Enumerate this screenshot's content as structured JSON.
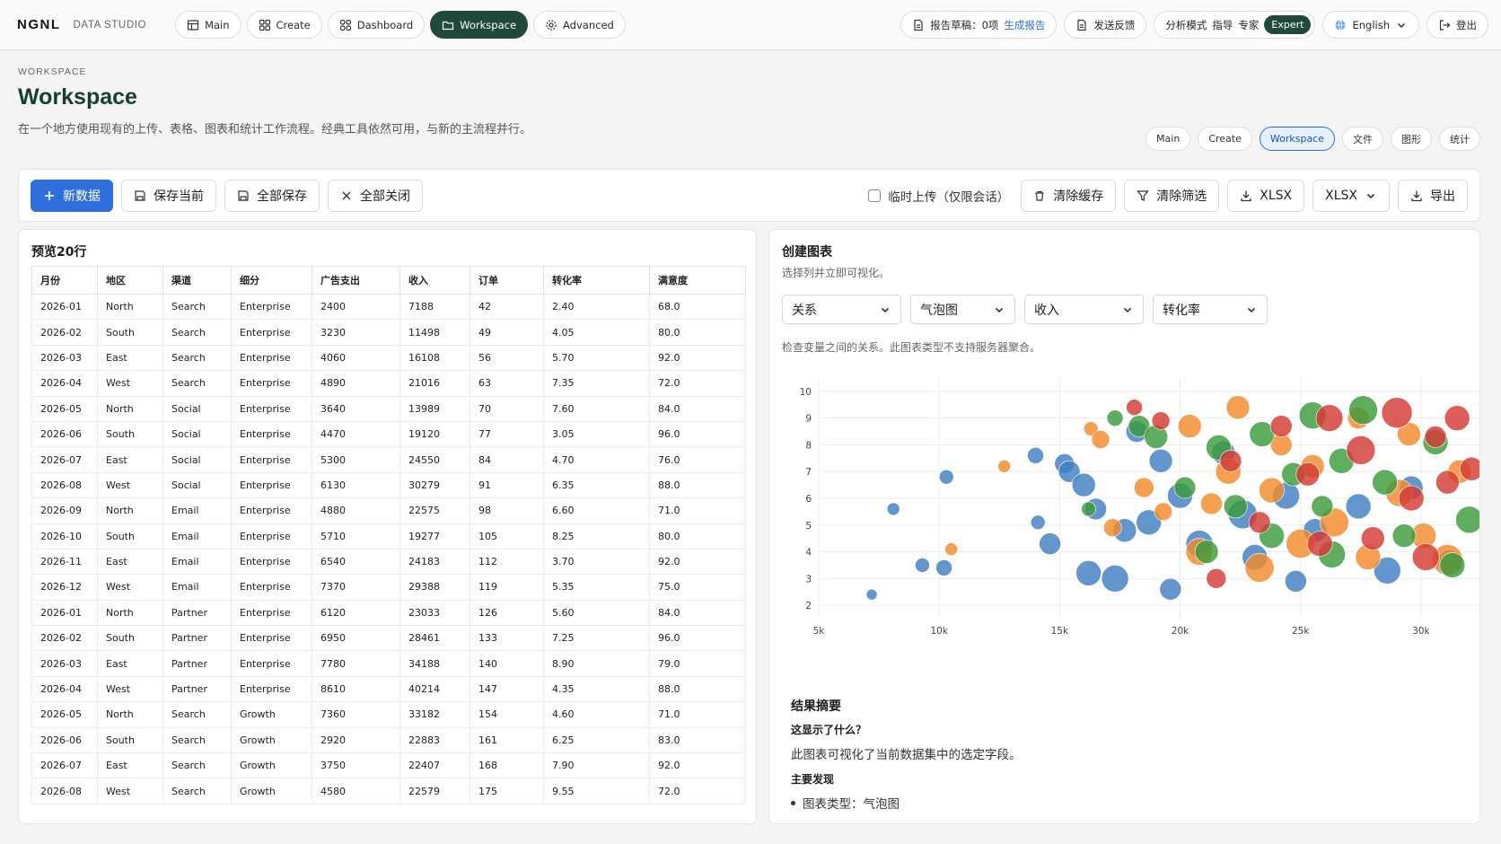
{
  "topbar": {
    "brand": "NGNL",
    "brand_sub": "DATA STUDIO",
    "nav": [
      {
        "label": "Main",
        "icon": "table-icon"
      },
      {
        "label": "Create",
        "icon": "grid-icon"
      },
      {
        "label": "Dashboard",
        "icon": "dashboard-icon"
      },
      {
        "label": "Workspace",
        "icon": "folder-icon",
        "active": true
      },
      {
        "label": "Advanced",
        "icon": "gear-icon"
      }
    ],
    "report_draft": "报告草稿：0项",
    "generate_report": "生成报告",
    "feedback": "发送反馈",
    "mode_label": "分析模式",
    "mode_guide": "指导",
    "mode_expert": "专家",
    "mode_active": "Expert",
    "language": "English",
    "logout": "登出"
  },
  "page": {
    "breadcrumb": "WORKSPACE",
    "title": "Workspace",
    "description": "在一个地方使用现有的上传、表格、图表和统计工作流程。经典工具依然可用，与新的主流程并行。",
    "subtabs": [
      "Main",
      "Create",
      "Workspace",
      "文件",
      "图形",
      "统计"
    ],
    "active_subtab": "Workspace"
  },
  "toolbar": {
    "new_data": "新数据",
    "save_current": "保存当前",
    "save_all": "全部保存",
    "close_all": "全部关闭",
    "temp_upload": "临时上传（仅限会话）",
    "clear_cache": "清除缓存",
    "clear_filters": "清除筛选",
    "download_xlsx": "XLSX",
    "format_select": "XLSX",
    "export": "导出"
  },
  "preview": {
    "title": "预览20行",
    "columns": [
      "月份",
      "地区",
      "渠道",
      "细分",
      "广告支出",
      "收入",
      "订单",
      "转化率",
      "满意度"
    ],
    "rows": [
      [
        "2026-01",
        "North",
        "Search",
        "Enterprise",
        "2400",
        "7188",
        "42",
        "2.40",
        "68.0"
      ],
      [
        "2026-02",
        "South",
        "Search",
        "Enterprise",
        "3230",
        "11498",
        "49",
        "4.05",
        "80.0"
      ],
      [
        "2026-03",
        "East",
        "Search",
        "Enterprise",
        "4060",
        "16108",
        "56",
        "5.70",
        "92.0"
      ],
      [
        "2026-04",
        "West",
        "Search",
        "Enterprise",
        "4890",
        "21016",
        "63",
        "7.35",
        "72.0"
      ],
      [
        "2026-05",
        "North",
        "Social",
        "Enterprise",
        "3640",
        "13989",
        "70",
        "7.60",
        "84.0"
      ],
      [
        "2026-06",
        "South",
        "Social",
        "Enterprise",
        "4470",
        "19120",
        "77",
        "3.05",
        "96.0"
      ],
      [
        "2026-07",
        "East",
        "Social",
        "Enterprise",
        "5300",
        "24550",
        "84",
        "4.70",
        "76.0"
      ],
      [
        "2026-08",
        "West",
        "Social",
        "Enterprise",
        "6130",
        "30279",
        "91",
        "6.35",
        "88.0"
      ],
      [
        "2026-09",
        "North",
        "Email",
        "Enterprise",
        "4880",
        "22575",
        "98",
        "6.60",
        "71.0"
      ],
      [
        "2026-10",
        "South",
        "Email",
        "Enterprise",
        "5710",
        "19277",
        "105",
        "8.25",
        "80.0"
      ],
      [
        "2026-11",
        "East",
        "Email",
        "Enterprise",
        "6540",
        "24183",
        "112",
        "3.70",
        "92.0"
      ],
      [
        "2026-12",
        "West",
        "Email",
        "Enterprise",
        "7370",
        "29388",
        "119",
        "5.35",
        "75.0"
      ],
      [
        "2026-01",
        "North",
        "Partner",
        "Enterprise",
        "6120",
        "23033",
        "126",
        "5.60",
        "84.0"
      ],
      [
        "2026-02",
        "South",
        "Partner",
        "Enterprise",
        "6950",
        "28461",
        "133",
        "7.25",
        "96.0"
      ],
      [
        "2026-03",
        "East",
        "Partner",
        "Enterprise",
        "7780",
        "34188",
        "140",
        "8.90",
        "79.0"
      ],
      [
        "2026-04",
        "West",
        "Partner",
        "Enterprise",
        "8610",
        "40214",
        "147",
        "4.35",
        "88.0"
      ],
      [
        "2026-05",
        "North",
        "Search",
        "Growth",
        "7360",
        "33182",
        "154",
        "4.60",
        "71.0"
      ],
      [
        "2026-06",
        "South",
        "Search",
        "Growth",
        "2920",
        "22883",
        "161",
        "6.25",
        "83.0"
      ],
      [
        "2026-07",
        "East",
        "Search",
        "Growth",
        "3750",
        "22407",
        "168",
        "7.90",
        "92.0"
      ],
      [
        "2026-08",
        "West",
        "Search",
        "Growth",
        "4580",
        "22579",
        "175",
        "9.55",
        "72.0"
      ]
    ]
  },
  "chart_panel": {
    "title": "创建图表",
    "subtitle": "选择列并立即可视化。",
    "selects": [
      "关系",
      "气泡图",
      "收入",
      "转化率"
    ],
    "note": "检查变量之间的关系。此图表类型不支持服务器聚合。",
    "summary_title": "结果摘要",
    "summary_question": "这显示了什么？",
    "summary_answer": "此图表可视化了当前数据集中的选定字段。",
    "key_findings": "主要发现",
    "finding_1": "图表类型：气泡图"
  },
  "chart_data": {
    "type": "scatter",
    "title": "",
    "xlabel": "",
    "ylabel": "",
    "xlim": [
      5000,
      32500
    ],
    "ylim": [
      1.5,
      10.5
    ],
    "x_ticks": [
      "5k",
      "10k",
      "15k",
      "20k",
      "25k",
      "30k"
    ],
    "y_ticks": [
      "2",
      "3",
      "4",
      "5",
      "6",
      "7",
      "8",
      "9",
      "10"
    ],
    "grid": true,
    "colors": [
      "#3f7fc1",
      "#f28a2b",
      "#3c9b3c",
      "#d43a34"
    ],
    "series": [
      {
        "color": "#3f7fc1",
        "points": [
          [
            7200,
            2.4,
            6
          ],
          [
            8100,
            5.6,
            7
          ],
          [
            9300,
            3.5,
            8
          ],
          [
            10200,
            3.4,
            9
          ],
          [
            10300,
            6.8,
            8
          ],
          [
            14000,
            7.6,
            9
          ],
          [
            14100,
            5.1,
            8
          ],
          [
            14600,
            4.3,
            12
          ],
          [
            15200,
            7.3,
            11
          ],
          [
            15400,
            7.0,
            12
          ],
          [
            16000,
            6.5,
            13
          ],
          [
            16200,
            3.2,
            14
          ],
          [
            16500,
            5.6,
            12
          ],
          [
            17300,
            3.0,
            15
          ],
          [
            17700,
            4.8,
            13
          ],
          [
            18200,
            8.5,
            12
          ],
          [
            18700,
            5.1,
            14
          ],
          [
            19200,
            7.4,
            13
          ],
          [
            19600,
            2.6,
            12
          ],
          [
            20000,
            6.1,
            14
          ],
          [
            20800,
            4.3,
            15
          ],
          [
            21800,
            7.7,
            13
          ],
          [
            22600,
            5.4,
            16
          ],
          [
            23100,
            3.8,
            14
          ],
          [
            24400,
            6.1,
            15
          ],
          [
            24800,
            2.9,
            12
          ],
          [
            25600,
            4.8,
            13
          ],
          [
            27400,
            5.7,
            14
          ],
          [
            28600,
            3.3,
            15
          ],
          [
            29600,
            6.4,
            13
          ],
          [
            31200,
            3.6,
            14
          ]
        ]
      },
      {
        "color": "#f28a2b",
        "points": [
          [
            10500,
            4.1,
            7
          ],
          [
            12700,
            7.2,
            7
          ],
          [
            16300,
            8.6,
            8
          ],
          [
            16700,
            8.2,
            10
          ],
          [
            17200,
            4.9,
            10
          ],
          [
            18500,
            6.4,
            11
          ],
          [
            19300,
            5.5,
            10
          ],
          [
            20400,
            8.7,
            13
          ],
          [
            20800,
            4.0,
            15
          ],
          [
            21300,
            5.8,
            12
          ],
          [
            22000,
            7.0,
            14
          ],
          [
            22400,
            9.4,
            13
          ],
          [
            23300,
            3.4,
            16
          ],
          [
            23800,
            6.3,
            14
          ],
          [
            24200,
            8.0,
            12
          ],
          [
            25000,
            4.3,
            16
          ],
          [
            25500,
            7.2,
            13
          ],
          [
            26400,
            5.1,
            16
          ],
          [
            27400,
            9.0,
            12
          ],
          [
            27800,
            3.8,
            14
          ],
          [
            29100,
            6.2,
            15
          ],
          [
            29500,
            8.4,
            13
          ],
          [
            30100,
            4.6,
            14
          ],
          [
            31100,
            3.7,
            17
          ],
          [
            31600,
            7.0,
            13
          ]
        ]
      },
      {
        "color": "#3c9b3c",
        "points": [
          [
            16200,
            5.6,
            8
          ],
          [
            17300,
            9.0,
            9
          ],
          [
            18300,
            8.7,
            12
          ],
          [
            19000,
            8.3,
            13
          ],
          [
            20200,
            6.4,
            12
          ],
          [
            21100,
            4.0,
            13
          ],
          [
            21600,
            7.9,
            14
          ],
          [
            22300,
            5.7,
            13
          ],
          [
            23400,
            8.4,
            14
          ],
          [
            23800,
            4.6,
            14
          ],
          [
            24700,
            6.9,
            13
          ],
          [
            25500,
            9.1,
            15
          ],
          [
            25900,
            5.7,
            12
          ],
          [
            26300,
            3.9,
            15
          ],
          [
            26700,
            7.4,
            14
          ],
          [
            27600,
            9.3,
            16
          ],
          [
            28500,
            6.6,
            14
          ],
          [
            29300,
            4.6,
            13
          ],
          [
            30600,
            8.1,
            14
          ],
          [
            31300,
            3.5,
            14
          ],
          [
            32000,
            5.2,
            15
          ]
        ]
      },
      {
        "color": "#d43a34",
        "points": [
          [
            18100,
            9.4,
            9
          ],
          [
            19200,
            8.9,
            10
          ],
          [
            21500,
            3.0,
            11
          ],
          [
            22100,
            7.4,
            12
          ],
          [
            23300,
            5.1,
            12
          ],
          [
            24200,
            8.7,
            12
          ],
          [
            25300,
            6.9,
            13
          ],
          [
            25800,
            4.3,
            14
          ],
          [
            26200,
            9.0,
            15
          ],
          [
            27500,
            7.8,
            16
          ],
          [
            28000,
            4.5,
            13
          ],
          [
            29000,
            9.2,
            17
          ],
          [
            29600,
            6.0,
            14
          ],
          [
            30200,
            3.8,
            15
          ],
          [
            30600,
            8.3,
            12
          ],
          [
            31100,
            6.6,
            13
          ],
          [
            31500,
            9.0,
            14
          ],
          [
            32100,
            7.1,
            13
          ]
        ]
      }
    ]
  }
}
